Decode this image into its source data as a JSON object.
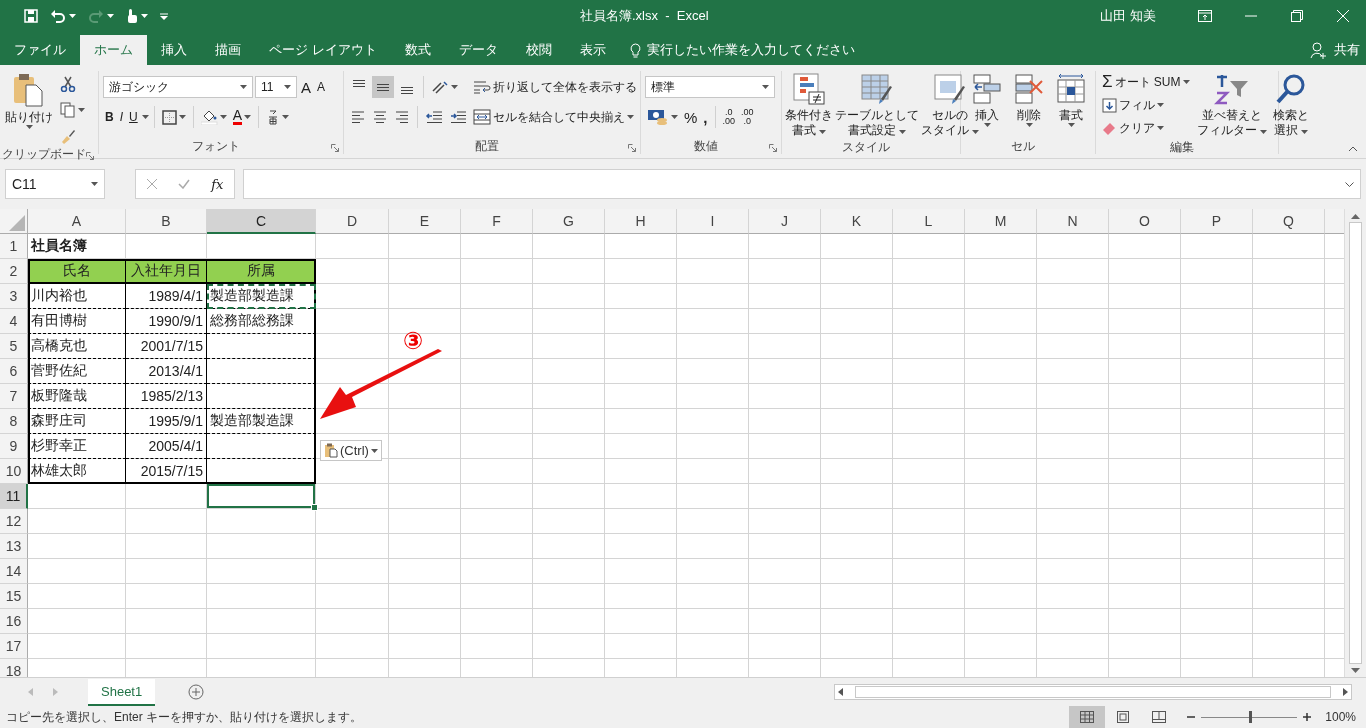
{
  "window": {
    "title": "社員名簿.xlsx  -  Excel",
    "user": "山田 知美"
  },
  "tabs": [
    {
      "label": "ファイル",
      "selected": false
    },
    {
      "label": "ホーム",
      "selected": true
    },
    {
      "label": "挿入",
      "selected": false
    },
    {
      "label": "描画",
      "selected": false
    },
    {
      "label": "ページ レイアウト",
      "selected": false
    },
    {
      "label": "数式",
      "selected": false
    },
    {
      "label": "データ",
      "selected": false
    },
    {
      "label": "校閲",
      "selected": false
    },
    {
      "label": "表示",
      "selected": false
    }
  ],
  "tell_me": {
    "placeholder": "実行したい作業を入力してください"
  },
  "share": "共有",
  "ribbon": {
    "clipboard": {
      "paste": "貼り付け",
      "label": "クリップボード"
    },
    "font": {
      "name": "游ゴシック",
      "size": "11",
      "grow": "A",
      "shrink": "A",
      "styles": [
        "B",
        "I",
        "U"
      ],
      "color_letter": "A",
      "label": "フォント"
    },
    "alignment": {
      "vertical": [
        {
          "selected": false
        },
        {
          "selected": true
        },
        {
          "selected": false
        }
      ],
      "wrap": "折り返して全体を表示する",
      "merge": "セルを結合して中央揃え",
      "label": "配置"
    },
    "number": {
      "format": "標準",
      "percent": "%",
      "comma": ",",
      "increase_decimal": [
        ".0",
        ".00"
      ],
      "decrease_decimal": [
        ".00",
        ".0"
      ],
      "label": "数値"
    },
    "styles": {
      "buttons": [
        {
          "lines": [
            "条件付き",
            "書式"
          ]
        },
        {
          "lines": [
            "テーブルとして",
            "書式設定"
          ]
        },
        {
          "lines": [
            "セルの",
            "スタイル"
          ]
        }
      ],
      "label": "スタイル"
    },
    "cells": {
      "buttons": [
        {
          "lines": [
            "挿入"
          ]
        },
        {
          "lines": [
            "削除"
          ]
        },
        {
          "lines": [
            "書式"
          ]
        }
      ],
      "label": "セル"
    },
    "editing": {
      "autosum_symbol": "Σ",
      "autosum": "オート SUM",
      "fill": "フィル",
      "clear": "クリア",
      "buttons": [
        {
          "lines": [
            "並べ替えと",
            "フィルター"
          ]
        },
        {
          "lines": [
            "検索と",
            "選択"
          ]
        }
      ],
      "label": "編集"
    }
  },
  "formula_bar": {
    "name_box": "C11",
    "fx": "fx"
  },
  "columns": [
    {
      "label": "A",
      "selected": false
    },
    {
      "label": "B",
      "selected": false
    },
    {
      "label": "C",
      "selected": true
    },
    {
      "label": "D",
      "selected": false
    },
    {
      "label": "E",
      "selected": false
    },
    {
      "label": "F",
      "selected": false
    },
    {
      "label": "G",
      "selected": false
    },
    {
      "label": "H",
      "selected": false
    },
    {
      "label": "I",
      "selected": false
    },
    {
      "label": "J",
      "selected": false
    },
    {
      "label": "K",
      "selected": false
    },
    {
      "label": "L",
      "selected": false
    },
    {
      "label": "M",
      "selected": false
    },
    {
      "label": "N",
      "selected": false
    },
    {
      "label": "O",
      "selected": false
    },
    {
      "label": "P",
      "selected": false
    },
    {
      "label": "Q",
      "selected": false
    }
  ],
  "rows": [
    {
      "header": "1",
      "kind": "title",
      "selected": false,
      "cells": [
        {
          "text": "社員名簿",
          "selected": false,
          "copied": false
        },
        {
          "selected": false,
          "copied": false
        },
        {
          "selected": false,
          "copied": false
        }
      ]
    },
    {
      "header": "2",
      "kind": "header",
      "selected": false,
      "cells": [
        {
          "text": "氏名",
          "selected": false,
          "copied": false
        },
        {
          "text": "入社年月日",
          "selected": false,
          "copied": false
        },
        {
          "text": "所属",
          "selected": false,
          "copied": false
        }
      ]
    },
    {
      "header": "3",
      "kind": "data",
      "selected": false,
      "cells": [
        {
          "text": "川内裕也",
          "selected": false,
          "copied": false
        },
        {
          "text": "1989/4/1",
          "selected": false,
          "copied": false
        },
        {
          "text": "製造部製造課",
          "selected": false,
          "copied": true
        }
      ]
    },
    {
      "header": "4",
      "kind": "data",
      "selected": false,
      "cells": [
        {
          "text": "有田博樹",
          "selected": false,
          "copied": false
        },
        {
          "text": "1990/9/1",
          "selected": false,
          "copied": false
        },
        {
          "text": "総務部総務課",
          "selected": false,
          "copied": false
        }
      ]
    },
    {
      "header": "5",
      "kind": "data",
      "selected": false,
      "cells": [
        {
          "text": "高橋克也",
          "selected": false,
          "copied": false
        },
        {
          "text": "2001/7/15",
          "selected": false,
          "copied": false
        },
        {
          "selected": false,
          "copied": false
        }
      ]
    },
    {
      "header": "6",
      "kind": "data",
      "selected": false,
      "cells": [
        {
          "text": "菅野佐紀",
          "selected": false,
          "copied": false
        },
        {
          "text": "2013/4/1",
          "selected": false,
          "copied": false
        },
        {
          "selected": false,
          "copied": false
        }
      ]
    },
    {
      "header": "7",
      "kind": "data",
      "selected": false,
      "cells": [
        {
          "text": "板野隆哉",
          "selected": false,
          "copied": false
        },
        {
          "text": "1985/2/13",
          "selected": false,
          "copied": false
        },
        {
          "selected": false,
          "copied": false
        }
      ]
    },
    {
      "header": "8",
      "kind": "data",
      "selected": false,
      "cells": [
        {
          "text": "森野庄司",
          "selected": false,
          "copied": false
        },
        {
          "text": "1995/9/1",
          "selected": false,
          "copied": false
        },
        {
          "text": "製造部製造課",
          "selected": false,
          "copied": false
        }
      ]
    },
    {
      "header": "9",
      "kind": "data",
      "selected": false,
      "cells": [
        {
          "text": "杉野幸正",
          "selected": false,
          "copied": false
        },
        {
          "text": "2005/4/1",
          "selected": false,
          "copied": false
        },
        {
          "selected": false,
          "copied": false
        }
      ]
    },
    {
      "header": "10",
      "kind": "data",
      "selected": false,
      "cells": [
        {
          "text": "林雄太郎",
          "selected": false,
          "copied": false
        },
        {
          "text": "2015/7/15",
          "selected": false,
          "copied": false
        },
        {
          "selected": false,
          "copied": false
        }
      ]
    },
    {
      "header": "11",
      "kind": "blank",
      "selected": true,
      "cells": [
        {
          "selected": false,
          "copied": false
        },
        {
          "selected": false,
          "copied": false
        },
        {
          "selected": true,
          "copied": false
        }
      ]
    },
    {
      "header": "12",
      "kind": "blank",
      "selected": false
    },
    {
      "header": "13",
      "kind": "blank",
      "selected": false
    },
    {
      "header": "14",
      "kind": "blank",
      "selected": false
    },
    {
      "header": "15",
      "kind": "blank",
      "selected": false
    },
    {
      "header": "16",
      "kind": "blank",
      "selected": false
    },
    {
      "header": "17",
      "kind": "blank",
      "selected": false
    },
    {
      "header": "18",
      "kind": "blank",
      "selected": false
    }
  ],
  "annotation": {
    "label": "③"
  },
  "paste_options": {
    "label": "(Ctrl)"
  },
  "sheets": [
    {
      "label": "Sheet1",
      "selected": true
    }
  ],
  "status_bar": {
    "message": "コピー先を選択し、Enter キーを押すか、貼り付けを選択します。",
    "views": [
      {
        "selected": true
      },
      {
        "selected": false
      },
      {
        "selected": false
      }
    ],
    "zoom": {
      "level": 0.5,
      "reading": "100%"
    }
  }
}
